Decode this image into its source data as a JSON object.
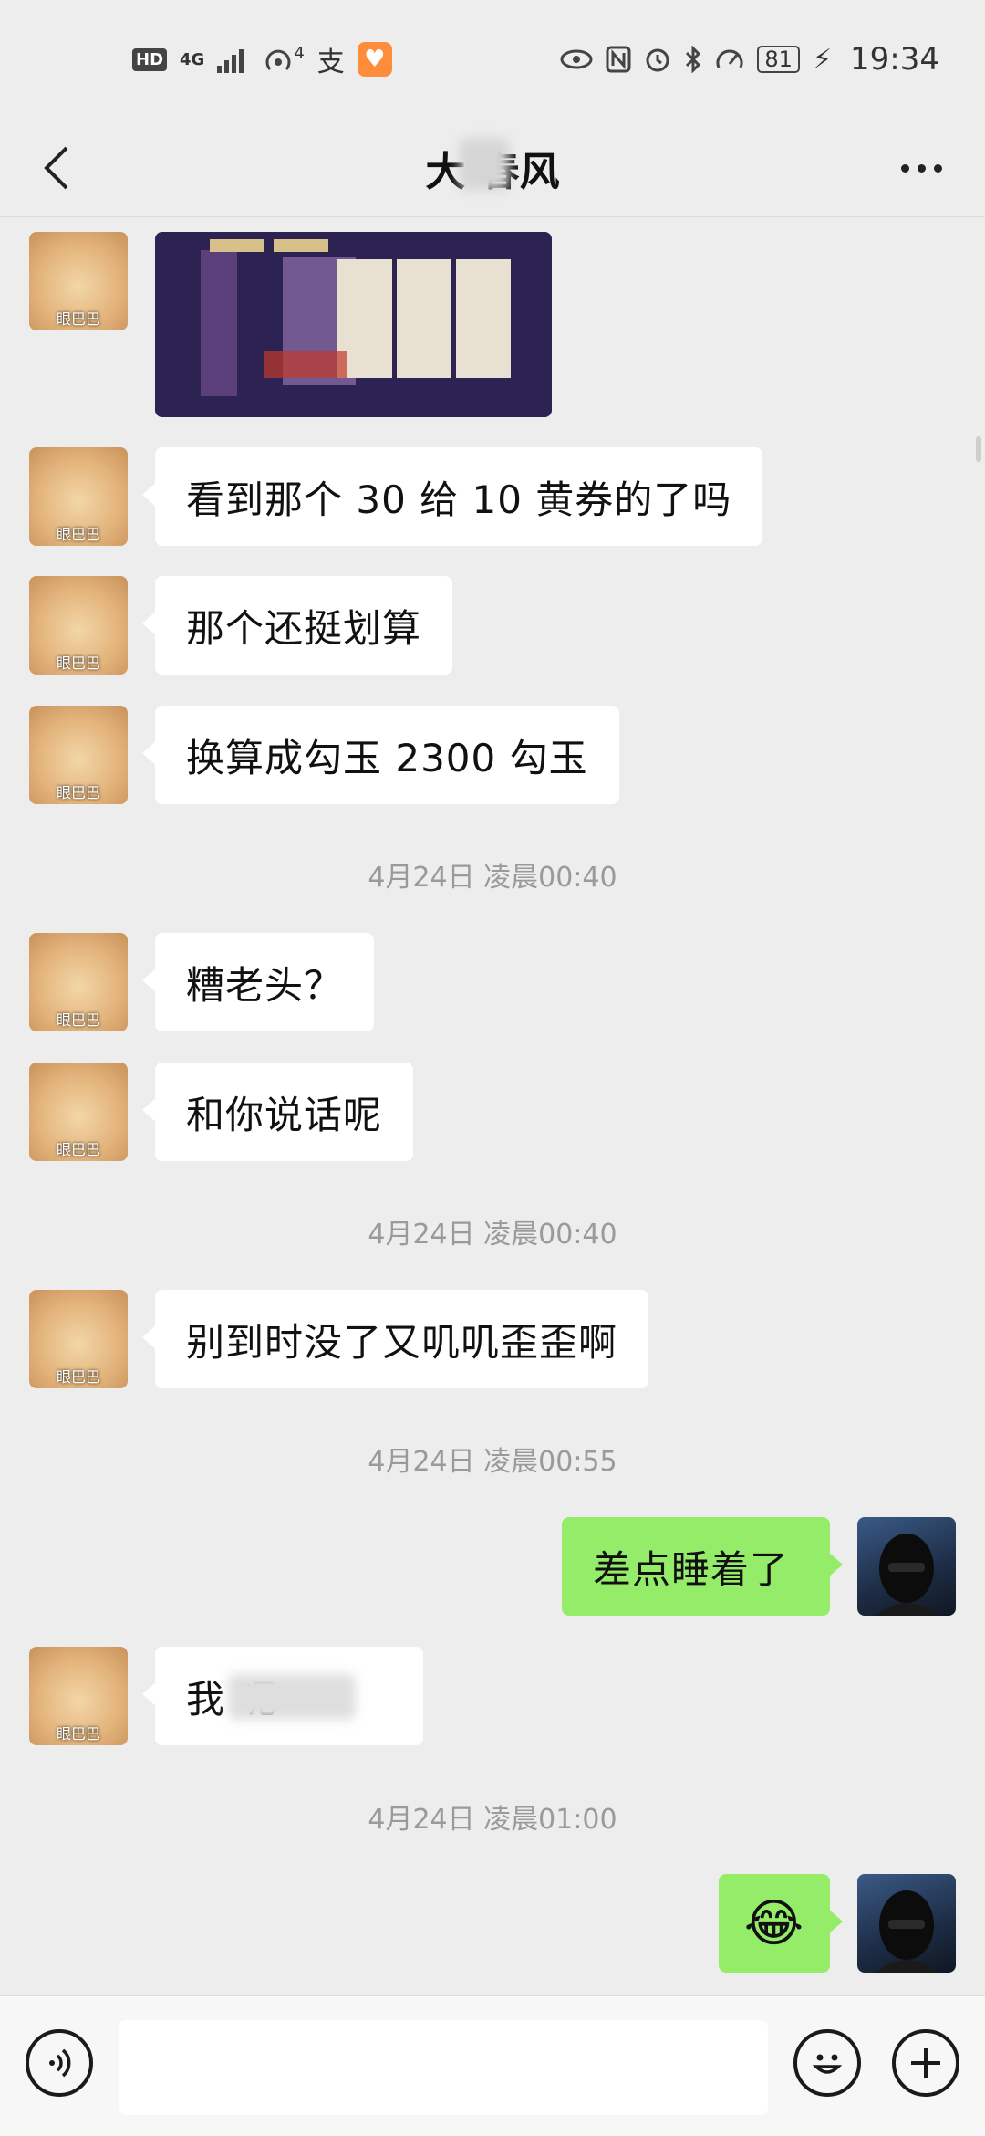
{
  "status_bar": {
    "time": "19:34",
    "battery": "81",
    "network": "4G",
    "hd": "HD",
    "wifi_sub": "4",
    "alipay": "支"
  },
  "header": {
    "title": "大 春风"
  },
  "messages": [
    {
      "type": "image",
      "side": "left"
    },
    {
      "type": "text",
      "side": "left",
      "text": "看到那个 30 给 10 黄券的了吗"
    },
    {
      "type": "text",
      "side": "left",
      "text": "那个还挺划算"
    },
    {
      "type": "text",
      "side": "left",
      "text": "换算成勾玉 2300 勾玉"
    },
    {
      "type": "time",
      "text": "4月24日 凌晨00:40"
    },
    {
      "type": "text",
      "side": "left",
      "text": "糟老头？"
    },
    {
      "type": "text",
      "side": "left",
      "text": "和你说话呢"
    },
    {
      "type": "time",
      "text": "4月24日 凌晨00:40"
    },
    {
      "type": "text",
      "side": "left",
      "text": "别到时没了又叽叽歪歪啊"
    },
    {
      "type": "time",
      "text": "4月24日 凌晨00:55"
    },
    {
      "type": "text",
      "side": "right",
      "text": "差点睡着了"
    },
    {
      "type": "text",
      "side": "left",
      "text": "我 呢"
    },
    {
      "type": "time",
      "text": "4月24日 凌晨01:00"
    },
    {
      "type": "emoji",
      "side": "right",
      "text": "😂"
    }
  ],
  "avatars": {
    "cat_label": "眼巴巴"
  },
  "input": {
    "value": "",
    "placeholder": ""
  },
  "colors": {
    "background": "#ededed",
    "bubble_self": "#95ec69",
    "bubble_other": "#ffffff",
    "timestamp": "#9a9a9a"
  },
  "icons": [
    "back-arrow-icon",
    "more-icon",
    "voice-icon",
    "emoji-icon",
    "plus-icon"
  ]
}
